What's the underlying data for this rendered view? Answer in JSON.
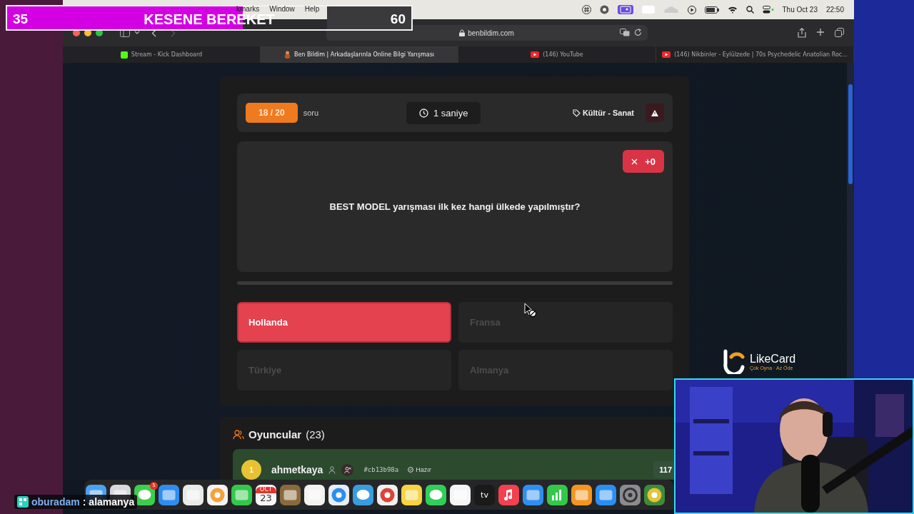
{
  "stream_overlay": {
    "current": "35",
    "title": "KESENE BEREKET",
    "goal": "60",
    "level": 0.583
  },
  "menu_bar": {
    "items": [
      "kmarks",
      "Window",
      "Help"
    ],
    "date": "Thu Oct 23",
    "time": "22:50"
  },
  "browser": {
    "url": "benbildim.com",
    "tabs": [
      {
        "title": "Stream - Kick Dashboard",
        "kind": "kick",
        "selected": false
      },
      {
        "title": "Ben Bildim | Arkadaşlarınla Online Bilgi Yarışması",
        "kind": "game",
        "selected": true
      },
      {
        "title": "(146) YouTube",
        "kind": "youtube",
        "selected": false
      },
      {
        "title": "(146) Nikbinler - Eylülzede | 70s Psychedelic Anatolian Roc...",
        "kind": "youtube",
        "selected": false
      }
    ]
  },
  "quiz": {
    "counter": "18 / 20",
    "counter_label": "soru",
    "timer": "1 saniye",
    "category": "Kültür - Sanat",
    "points": "+0",
    "question": "BEST MODEL yarışması ilk kez hangi ülkede yapılmıştır?",
    "progress": {
      "level": 0
    },
    "options": [
      {
        "label": "Hollanda",
        "selected": true
      },
      {
        "label": "Fransa",
        "selected": false
      },
      {
        "label": "Türkiye",
        "selected": false
      },
      {
        "label": "Almanya",
        "selected": false
      }
    ]
  },
  "players": {
    "title": "Oyuncular",
    "count": "(23)",
    "rows": [
      {
        "rank": "1",
        "name": "ahmetkaya",
        "code": "#cb13b98a",
        "status": "Hazır",
        "score": "117"
      }
    ]
  },
  "sponsor": {
    "name": "LikeCard",
    "slogan": "Çok Oyna · Az Öde"
  },
  "chat": {
    "user": "oburadam",
    "separator": ":",
    "message": "alamanya"
  },
  "dock": {
    "apps": [
      {
        "kind": "finder"
      },
      {
        "kind": "launchpad"
      },
      {
        "kind": "messages",
        "badge": "5"
      },
      {
        "kind": "mail"
      },
      {
        "kind": "maps"
      },
      {
        "kind": "photos"
      },
      {
        "kind": "facetime"
      },
      {
        "kind": "calendar",
        "month": "OCT",
        "day": "23"
      },
      {
        "kind": "archive"
      },
      {
        "kind": "reminders"
      },
      {
        "kind": "safari"
      },
      {
        "kind": "telegram"
      },
      {
        "kind": "chrome"
      },
      {
        "kind": "notes"
      },
      {
        "kind": "whatsapp"
      },
      {
        "kind": "freeform"
      },
      {
        "kind": "tv",
        "label": "tv"
      },
      {
        "kind": "music"
      },
      {
        "kind": "keynote"
      },
      {
        "kind": "numbers"
      },
      {
        "kind": "pages"
      },
      {
        "kind": "appstore"
      },
      {
        "kind": "settings"
      },
      {
        "kind": "globe"
      }
    ]
  }
}
